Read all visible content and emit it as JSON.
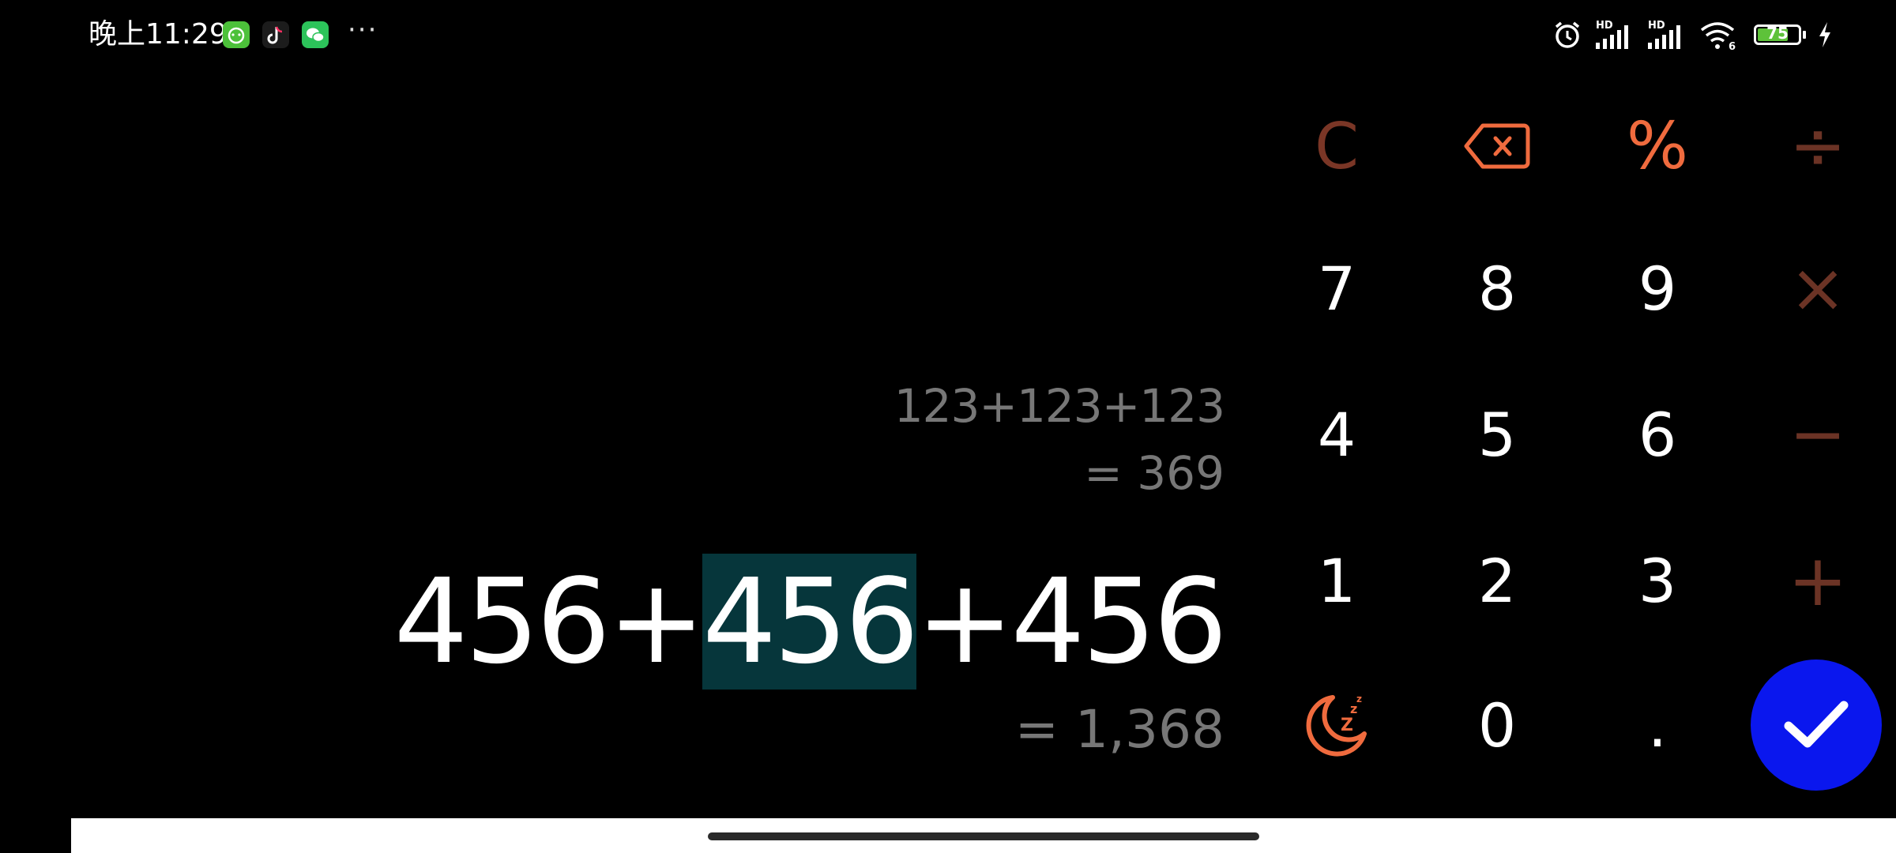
{
  "status_bar": {
    "time": "晚上11:29",
    "more": "···",
    "battery_level": "75",
    "icons": [
      "green-app-icon",
      "tiktok-icon",
      "wechat-icon",
      "alarm-icon",
      "hd-signal-icon",
      "hd-signal-icon",
      "wifi-6-icon",
      "battery-icon",
      "charging-icon"
    ],
    "hd_label": "HD"
  },
  "display": {
    "history_expression": "123+123+123",
    "history_result": "= 369",
    "current_expression_before": "456+",
    "current_expression_selected": "456",
    "current_expression_after": "+456",
    "current_result": "= 1,368"
  },
  "keypad": {
    "clear": "C",
    "percent": "%",
    "divide": "÷",
    "multiply": "×",
    "minus": "−",
    "plus": "+",
    "seven": "7",
    "eight": "8",
    "nine": "9",
    "four": "4",
    "five": "5",
    "six": "6",
    "one": "1",
    "two": "2",
    "three": "3",
    "zero": "0",
    "dot": ".",
    "icons": {
      "backspace": "backspace-icon",
      "night": "moon-sleep-icon",
      "confirm": "check-icon"
    }
  },
  "colors": {
    "background": "#000000",
    "operator_dark": "#6b3325",
    "operator_orange": "#f06b3e",
    "selection": "#06363b",
    "confirm": "#0a17ee",
    "secondary_text": "#777777"
  }
}
